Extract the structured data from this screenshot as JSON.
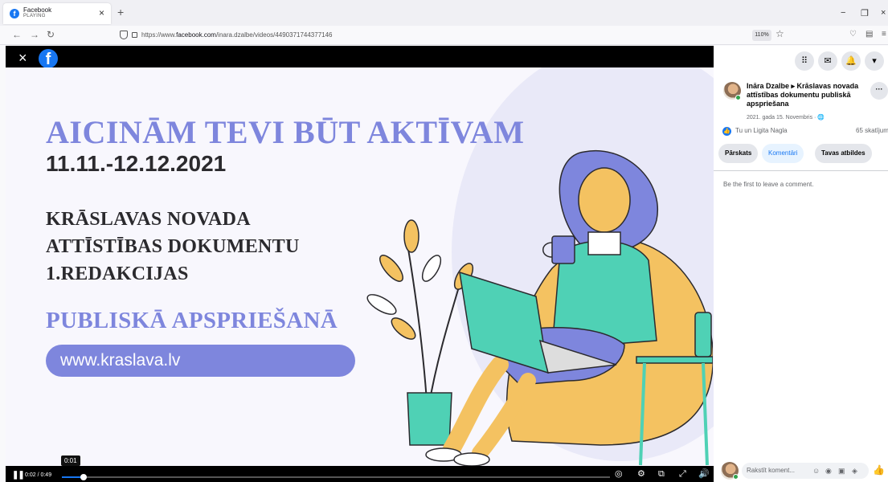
{
  "browser": {
    "tab_title": "Facebook",
    "tab_status": "PLAYING",
    "url_prefix": "https://www.",
    "url_host": "facebook.com",
    "url_path": "/inara.dzalbe/videos/4490371744377146",
    "zoom": "110%"
  },
  "slide": {
    "headline": "AICINĀM TEVI BŪT AKTĪVAM",
    "dates": "11.11.-12.12.2021",
    "line1": "KRĀSLAVAS NOVADA",
    "line2": "ATTĪSTĪBAS DOKUMENTU",
    "line3": "1.REDAKCIJAS",
    "highlight": "PUBLISKĀ APSPRIEŠANĀ",
    "website": "www.kraslava.lv"
  },
  "player": {
    "tooltip": "0:01",
    "time": "0:02 / 0:49",
    "progress_fraction": 0.04
  },
  "panel": {
    "post_title": "Ināra Dzalbe ▸ Krāslavas novada attīstības dokumentu publiskā apspriešana",
    "post_meta": "2021. gada 15. Novembris · 🌐",
    "likers": "Tu un Ligita Nagla",
    "views": "65 skatījumi",
    "tabs": [
      "Pārskats",
      "Komentāri",
      "Tavas atbildes"
    ],
    "empty_comments": "Be the first to leave a comment.",
    "comment_placeholder": "Rakstīt koment..."
  },
  "colors": {
    "facebook_blue": "#1877f2",
    "slide_accent": "#7e86dd"
  }
}
